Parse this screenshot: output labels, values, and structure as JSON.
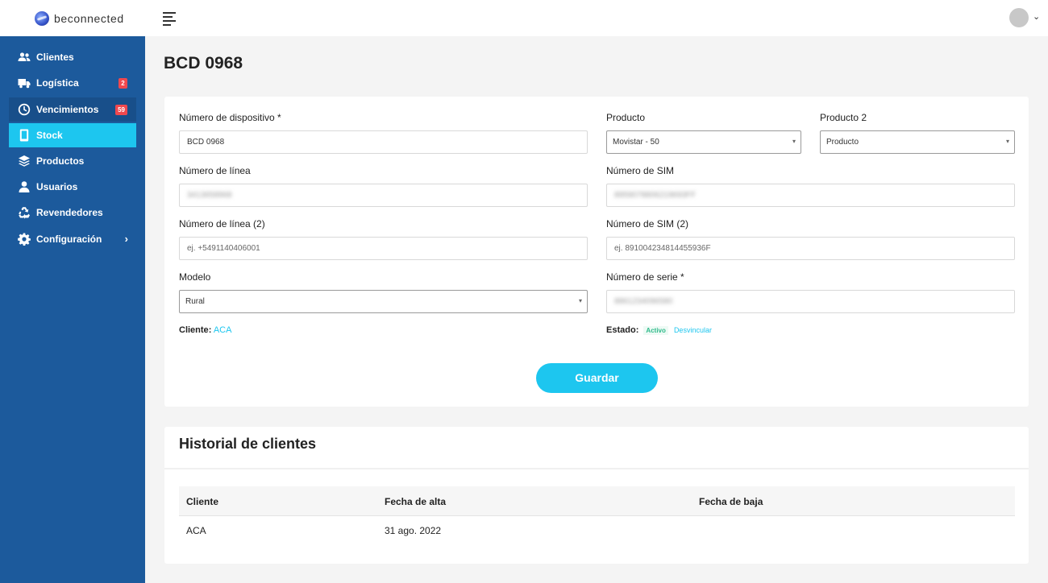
{
  "brand": {
    "name": "beconnected"
  },
  "sidebar": {
    "items": [
      {
        "label": "Clientes",
        "icon": "users-icon"
      },
      {
        "label": "Logística",
        "icon": "truck-icon",
        "badge": "2"
      },
      {
        "label": "Vencimientos",
        "icon": "clock-icon",
        "badge": "59"
      },
      {
        "label": "Stock",
        "icon": "mobile-icon",
        "active": true
      },
      {
        "label": "Productos",
        "icon": "layers-icon"
      },
      {
        "label": "Usuarios",
        "icon": "user-icon"
      },
      {
        "label": "Revendedores",
        "icon": "recycle-icon"
      },
      {
        "label": "Configuración",
        "icon": "gear-icon"
      }
    ]
  },
  "page": {
    "title": "BCD 0968"
  },
  "form": {
    "device_number": {
      "label": "Número de dispositivo *",
      "value": "BCD 0968"
    },
    "product": {
      "label": "Producto",
      "value": "Movistar - 50"
    },
    "product2": {
      "label": "Producto 2",
      "value": "Producto"
    },
    "line_number": {
      "label": "Número de línea",
      "value": "3413658968"
    },
    "sim_number": {
      "label": "Número de SIM",
      "value": "8959078806219693FF"
    },
    "line_number2": {
      "label": "Número de línea (2)",
      "placeholder": "ej. +5491140406001"
    },
    "sim_number2": {
      "label": "Número de SIM (2)",
      "placeholder": "ej. 891004234814455936F"
    },
    "model": {
      "label": "Modelo",
      "value": "Rural"
    },
    "serial_number": {
      "label": "Número de serie *",
      "value": "8861234096580"
    },
    "client": {
      "label": "Cliente",
      "value": "ACA"
    },
    "status": {
      "label": "Estado",
      "value": "Activo",
      "unlink_label": "Desvincular"
    },
    "save_label": "Guardar"
  },
  "history": {
    "title": "Historial de clientes",
    "columns": [
      "Cliente",
      "Fecha de alta",
      "Fecha de baja"
    ],
    "rows": [
      [
        "ACA",
        "31 ago. 2022",
        ""
      ]
    ]
  },
  "colors": {
    "sidebar": "#1c5a9c",
    "accent": "#1dc6ef",
    "badge": "#f0484e",
    "active_status": "#2fba8a"
  }
}
